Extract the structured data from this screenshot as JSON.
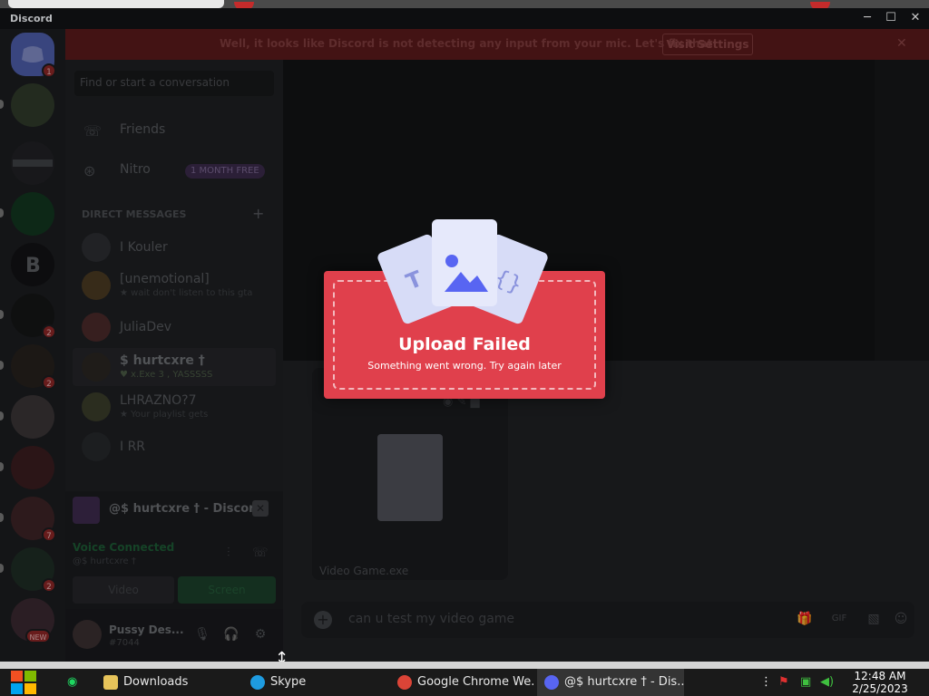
{
  "window": {
    "app_name": "Discord",
    "minimize": "─",
    "maximize": "☐",
    "close": "✕"
  },
  "notice": {
    "message": "Well, it looks like Discord is not detecting any input from your mic. Let's fix that!",
    "button": "Visit Settings",
    "close": "✕"
  },
  "rail": {
    "servers": [
      {
        "name": "home",
        "badge": "1"
      },
      {
        "name": "server-2",
        "badge": ""
      },
      {
        "name": "server-3",
        "badge": ""
      },
      {
        "name": "server-4",
        "badge": ""
      },
      {
        "name": "server-5",
        "badge": ""
      },
      {
        "name": "server-6",
        "badge": "2"
      },
      {
        "name": "server-7",
        "badge": "2"
      },
      {
        "name": "server-8",
        "badge": ""
      },
      {
        "name": "server-9",
        "badge": ""
      },
      {
        "name": "server-10",
        "badge": "7"
      },
      {
        "name": "server-11",
        "badge": "2"
      },
      {
        "name": "server-12",
        "badge": "NEW"
      }
    ]
  },
  "sidebar": {
    "search_placeholder": "Find or start a conversation",
    "friends": "Friends",
    "nitro": "Nitro",
    "nitro_promo": "1 MONTH FREE",
    "dm_header": "DIRECT MESSAGES",
    "dm_plus": "+",
    "dms": [
      {
        "name": "I Kouler",
        "sub": ""
      },
      {
        "name": "[unemotional]",
        "sub": "★ wait don't listen to this gta"
      },
      {
        "name": "JuliaDev",
        "sub": ""
      },
      {
        "name": "$ hurtcxre †",
        "sub": "♥ x.Exe 3 , YASSSSS"
      },
      {
        "name": "LHRAZNO?7",
        "sub": "★ Your playlist gets"
      },
      {
        "name": "I RR",
        "sub": ""
      }
    ],
    "call": {
      "title": "@$ hurtcxre † - Discord",
      "close": "✕",
      "status": "Voice Connected",
      "sub": "@$ hurtcxre †",
      "video": "Video",
      "screen": "Screen"
    },
    "user": {
      "name": "Pussy Des...",
      "tag": "#7044"
    }
  },
  "main": {
    "attachment_name": "Video Game.exe",
    "composer_text": "can u test my video game"
  },
  "modal": {
    "title": "Upload Failed",
    "subtitle": "Something went wrong. Try again later"
  },
  "taskbar": {
    "items": [
      {
        "label": "Downloads",
        "color": "#e6c35a"
      },
      {
        "label": "Skype",
        "color": "#1e9be0"
      },
      {
        "label": "Google Chrome We...",
        "color": "#e6c35a"
      },
      {
        "label": "@$ hurtcxre † - Dis...",
        "color": "#5865f2"
      }
    ],
    "time": "12:48 AM",
    "date": "2/25/2023"
  },
  "colors": {
    "accent": "#5865f2",
    "error": "#e0404c",
    "taskbar": "#1a1a1a"
  }
}
